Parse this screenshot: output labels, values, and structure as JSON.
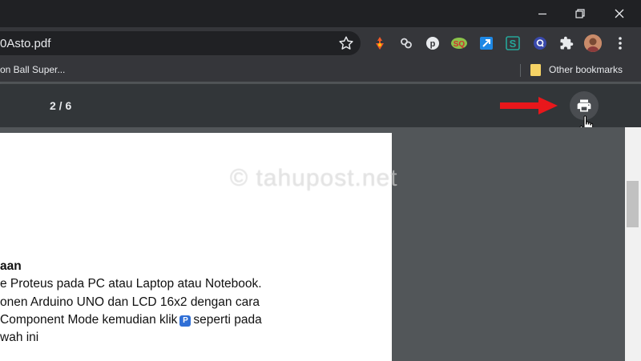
{
  "browser": {
    "url_text": "0Asto.pdf",
    "window_controls": {
      "minimize_icon": "minimize-icon",
      "restore_icon": "restore-icon",
      "close_icon": "close-icon"
    }
  },
  "extensions": [
    {
      "name": "extension-1-icon"
    },
    {
      "name": "link-extension-icon"
    },
    {
      "name": "pinterest-extension-icon"
    },
    {
      "name": "seoquake-extension-icon",
      "label": "SQ"
    },
    {
      "name": "external-link-extension-icon"
    },
    {
      "name": "s-extension-icon",
      "label": "S"
    },
    {
      "name": "q-extension-icon",
      "label": "Q"
    },
    {
      "name": "extensions-puzzle-icon"
    },
    {
      "name": "profile-avatar"
    },
    {
      "name": "more-menu-icon"
    }
  ],
  "bookmarks": {
    "item_1": "on Ball Super...",
    "other": "Other bookmarks"
  },
  "pdf_toolbar": {
    "page_indicator": "2 / 6"
  },
  "document": {
    "heading": "aan",
    "line_1": "e Proteus pada PC atau Laptop atau Notebook.",
    "line_2": "onen Arduino UNO dan LCD 16x2 dengan cara",
    "line_3a": "Component  Mode kemudian klik",
    "line_3_icon": "P",
    "line_3b": "seperti pada",
    "line_4": "wah ini"
  },
  "watermark": "© tahupost.net",
  "colors": {
    "titlebar": "#202124",
    "toolbar": "#35363a",
    "pdf_toolbar": "#323639",
    "viewer_bg": "#525659",
    "annotation_arrow": "#e8171b"
  }
}
